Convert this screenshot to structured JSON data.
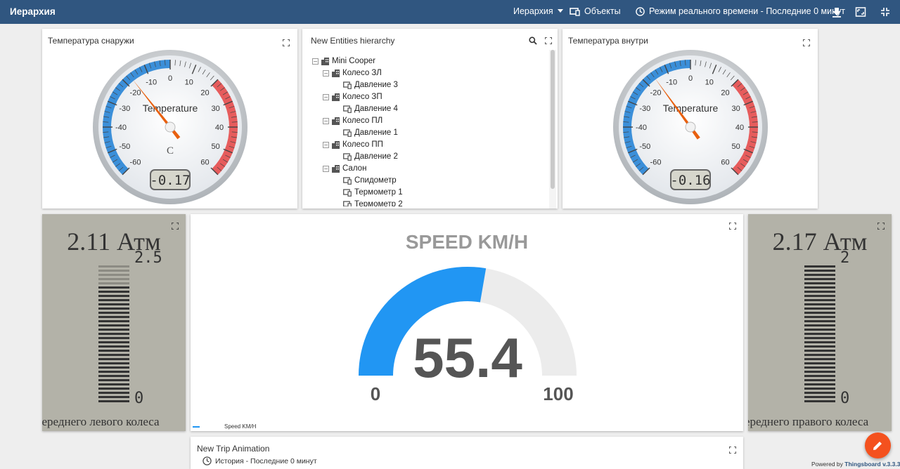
{
  "topbar": {
    "title": "Иерархия",
    "state_label": "Иерархия",
    "objects_label": "Объекты",
    "timewindow_label": "Режим реального времени - Последние 0 минут"
  },
  "panels": {
    "outside_temp": {
      "title": "Температура снаружи",
      "gauge_title": "Temperature",
      "unit": "C",
      "value_display": "-0.17",
      "value": -17
    },
    "hierarchy": {
      "title": "New Entities hierarchy",
      "tree": [
        {
          "label": "Mini Cooper",
          "level": 0,
          "type": "asset",
          "toggle": "−"
        },
        {
          "label": "Колесо ЗЛ",
          "level": 1,
          "type": "asset",
          "toggle": "−"
        },
        {
          "label": "Давление 3",
          "level": 2,
          "type": "device"
        },
        {
          "label": "Колесо ЗП",
          "level": 1,
          "type": "asset",
          "toggle": "−"
        },
        {
          "label": "Давление 4",
          "level": 2,
          "type": "device"
        },
        {
          "label": "Колесо ПЛ",
          "level": 1,
          "type": "asset",
          "toggle": "−"
        },
        {
          "label": "Давление 1",
          "level": 2,
          "type": "device"
        },
        {
          "label": "Колесо ПП",
          "level": 1,
          "type": "asset",
          "toggle": "−"
        },
        {
          "label": "Давление 2",
          "level": 2,
          "type": "device"
        },
        {
          "label": "Салон",
          "level": 1,
          "type": "asset",
          "toggle": "−"
        },
        {
          "label": "Спидометр",
          "level": 2,
          "type": "device"
        },
        {
          "label": "Термометр 1",
          "level": 2,
          "type": "device"
        },
        {
          "label": "Термометр 2",
          "level": 2,
          "type": "device"
        }
      ]
    },
    "inside_temp": {
      "title": "Температура внутри",
      "gauge_title": "Temperature",
      "value_display": "-0.16",
      "value": -16
    },
    "pressure_left": {
      "value_text": "2.11 Атм",
      "max": "2.5",
      "min": "0",
      "label": "Давление переднего левого колеса",
      "level_fraction": 0.844
    },
    "speed": {
      "title": "SPEED KM/H",
      "value": "55.4",
      "min": "0",
      "max": "100",
      "legend": "Speed KM/H",
      "color": "#2196f3"
    },
    "pressure_right": {
      "value_text": "2.17 Атм",
      "max": "2",
      "min": "0",
      "label": "Давление переднего правого колеса",
      "level_fraction": 1.0
    },
    "trip": {
      "title": "New Trip Animation",
      "history_label": "История - Последние 0 минут"
    }
  },
  "gauge_ticks": [
    "-60",
    "-50",
    "-40",
    "-30",
    "-20",
    "-10",
    "0",
    "10",
    "20",
    "30",
    "40",
    "50",
    "60"
  ],
  "footer": {
    "powered_by": "Powered by",
    "brand": "Thingsboard v.3.3.3"
  },
  "colors": {
    "topbar": "#305680",
    "accent": "#2196f3",
    "fab": "#f4511e",
    "cold_band": "#3b8fd9",
    "hot_band": "#e65c5c"
  },
  "icons": [
    "chevron-down-icon",
    "devices-icon",
    "clock-icon",
    "download-icon",
    "fullscreen-icon",
    "fullscreen-exit-icon",
    "search-icon",
    "pencil-icon"
  ]
}
